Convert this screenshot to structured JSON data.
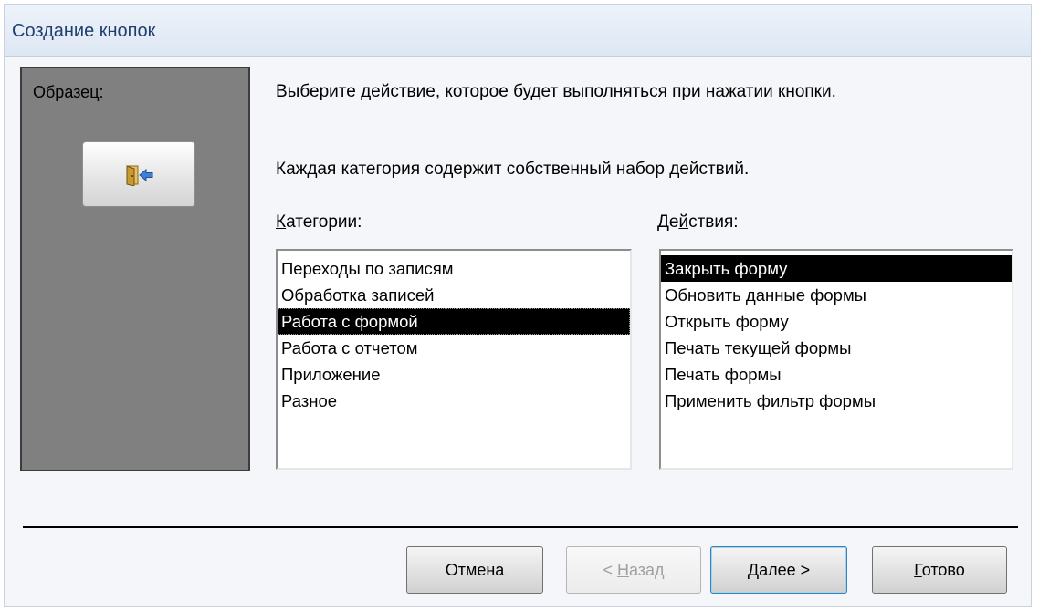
{
  "window": {
    "title": "Создание кнопок"
  },
  "sample": {
    "label": "Образец:",
    "icon": "exit-door-icon"
  },
  "instructions": {
    "line1": "Выберите действие, которое будет выполняться при нажатии кнопки.",
    "line2": "Каждая категория содержит собственный набор действий."
  },
  "categories": {
    "label_prefix": "",
    "label_accel": "К",
    "label_rest": "атегории:",
    "items": [
      "Переходы по записям",
      "Обработка записей",
      "Работа с формой",
      "Работа с отчетом",
      "Приложение",
      "Разное"
    ],
    "selected_index": 2
  },
  "actions": {
    "label_prefix": "Де",
    "label_accel": "й",
    "label_rest": "ствия:",
    "items": [
      "Закрыть форму",
      "Обновить данные формы",
      "Открыть форму",
      "Печать текущей формы",
      "Печать формы",
      "Применить фильтр формы"
    ],
    "selected_index": 0
  },
  "buttons": {
    "cancel": "Отмена",
    "back_prefix": "< ",
    "back_accel": "Н",
    "back_rest": "азад",
    "next_accel": "Д",
    "next_rest": "алее >",
    "finish_accel": "Г",
    "finish_rest": "отово"
  }
}
